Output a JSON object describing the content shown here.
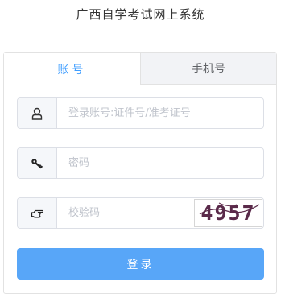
{
  "header": {
    "title": "广西自学考试网上系统"
  },
  "tabs": [
    {
      "label": "账号",
      "active": true
    },
    {
      "label": "手机号",
      "active": false
    }
  ],
  "form": {
    "username": {
      "placeholder": "登录账号:证件号/准考证号",
      "value": "",
      "icon": "user-icon"
    },
    "password": {
      "placeholder": "密码",
      "value": "",
      "icon": "key-icon"
    },
    "captcha": {
      "placeholder": "校验码",
      "value": "",
      "icon": "pointing-hand-icon",
      "image_text": "4957"
    }
  },
  "login_button": {
    "label": "登录"
  },
  "colors": {
    "accent": "#409eff",
    "button": "#58a6f8",
    "tab_inactive_bg": "#f2f3f6",
    "border": "#dcdfe6"
  }
}
